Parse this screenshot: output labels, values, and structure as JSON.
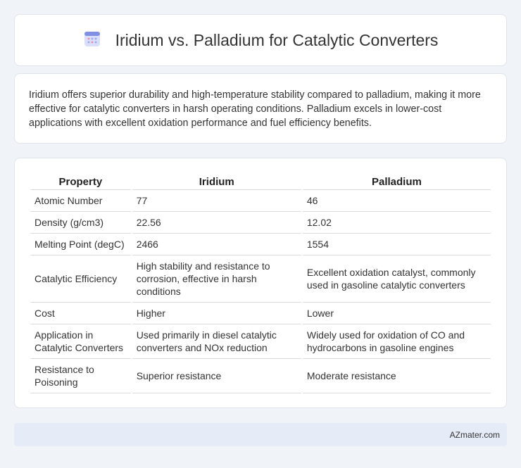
{
  "header": {
    "title": "Iridium vs. Palladium for Catalytic Converters",
    "icon": "calendar-icon",
    "accent_color": "#6b7fd7"
  },
  "intro": {
    "text": "Iridium offers superior durability and high-temperature stability compared to palladium, making it more effective for catalytic converters in harsh operating conditions. Palladium excels in lower-cost applications with excellent oxidation performance and fuel efficiency benefits."
  },
  "table": {
    "headers": [
      "Property",
      "Iridium",
      "Palladium"
    ],
    "rows": [
      [
        "Atomic Number",
        "77",
        "46"
      ],
      [
        "Density (g/cm3)",
        "22.56",
        "12.02"
      ],
      [
        "Melting Point (degC)",
        "2466",
        "1554"
      ],
      [
        "Catalytic Efficiency",
        "High stability and resistance to corrosion, effective in harsh conditions",
        "Excellent oxidation catalyst, commonly used in gasoline catalytic converters"
      ],
      [
        "Cost",
        "Higher",
        "Lower"
      ],
      [
        "Application in Catalytic Converters",
        "Used primarily in diesel catalytic converters and NOx reduction",
        "Widely used for oxidation of CO and hydrocarbons in gasoline engines"
      ],
      [
        "Resistance to Poisoning",
        "Superior resistance",
        "Moderate resistance"
      ]
    ]
  },
  "footer": {
    "brand": "AZmater.com"
  }
}
